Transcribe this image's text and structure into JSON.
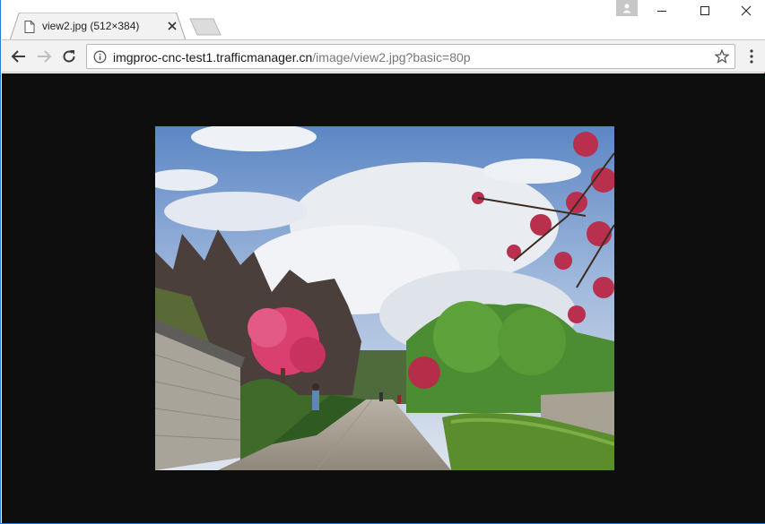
{
  "tab": {
    "title": "view2.jpg (512×384)",
    "favicon": "document-icon"
  },
  "window_controls": [
    "minimize-icon",
    "maximize-icon",
    "close-icon"
  ],
  "address_bar": {
    "host": "imgproc-cnc-test1.trafficmanager.cn",
    "path": "/image/view2.jpg?basic=80p"
  },
  "image": {
    "description_icon": "photo"
  },
  "colors": {
    "content_background": "#0e0e0e",
    "toolbar_background": "#f2f2f2",
    "window_border": "#2b79d8"
  }
}
